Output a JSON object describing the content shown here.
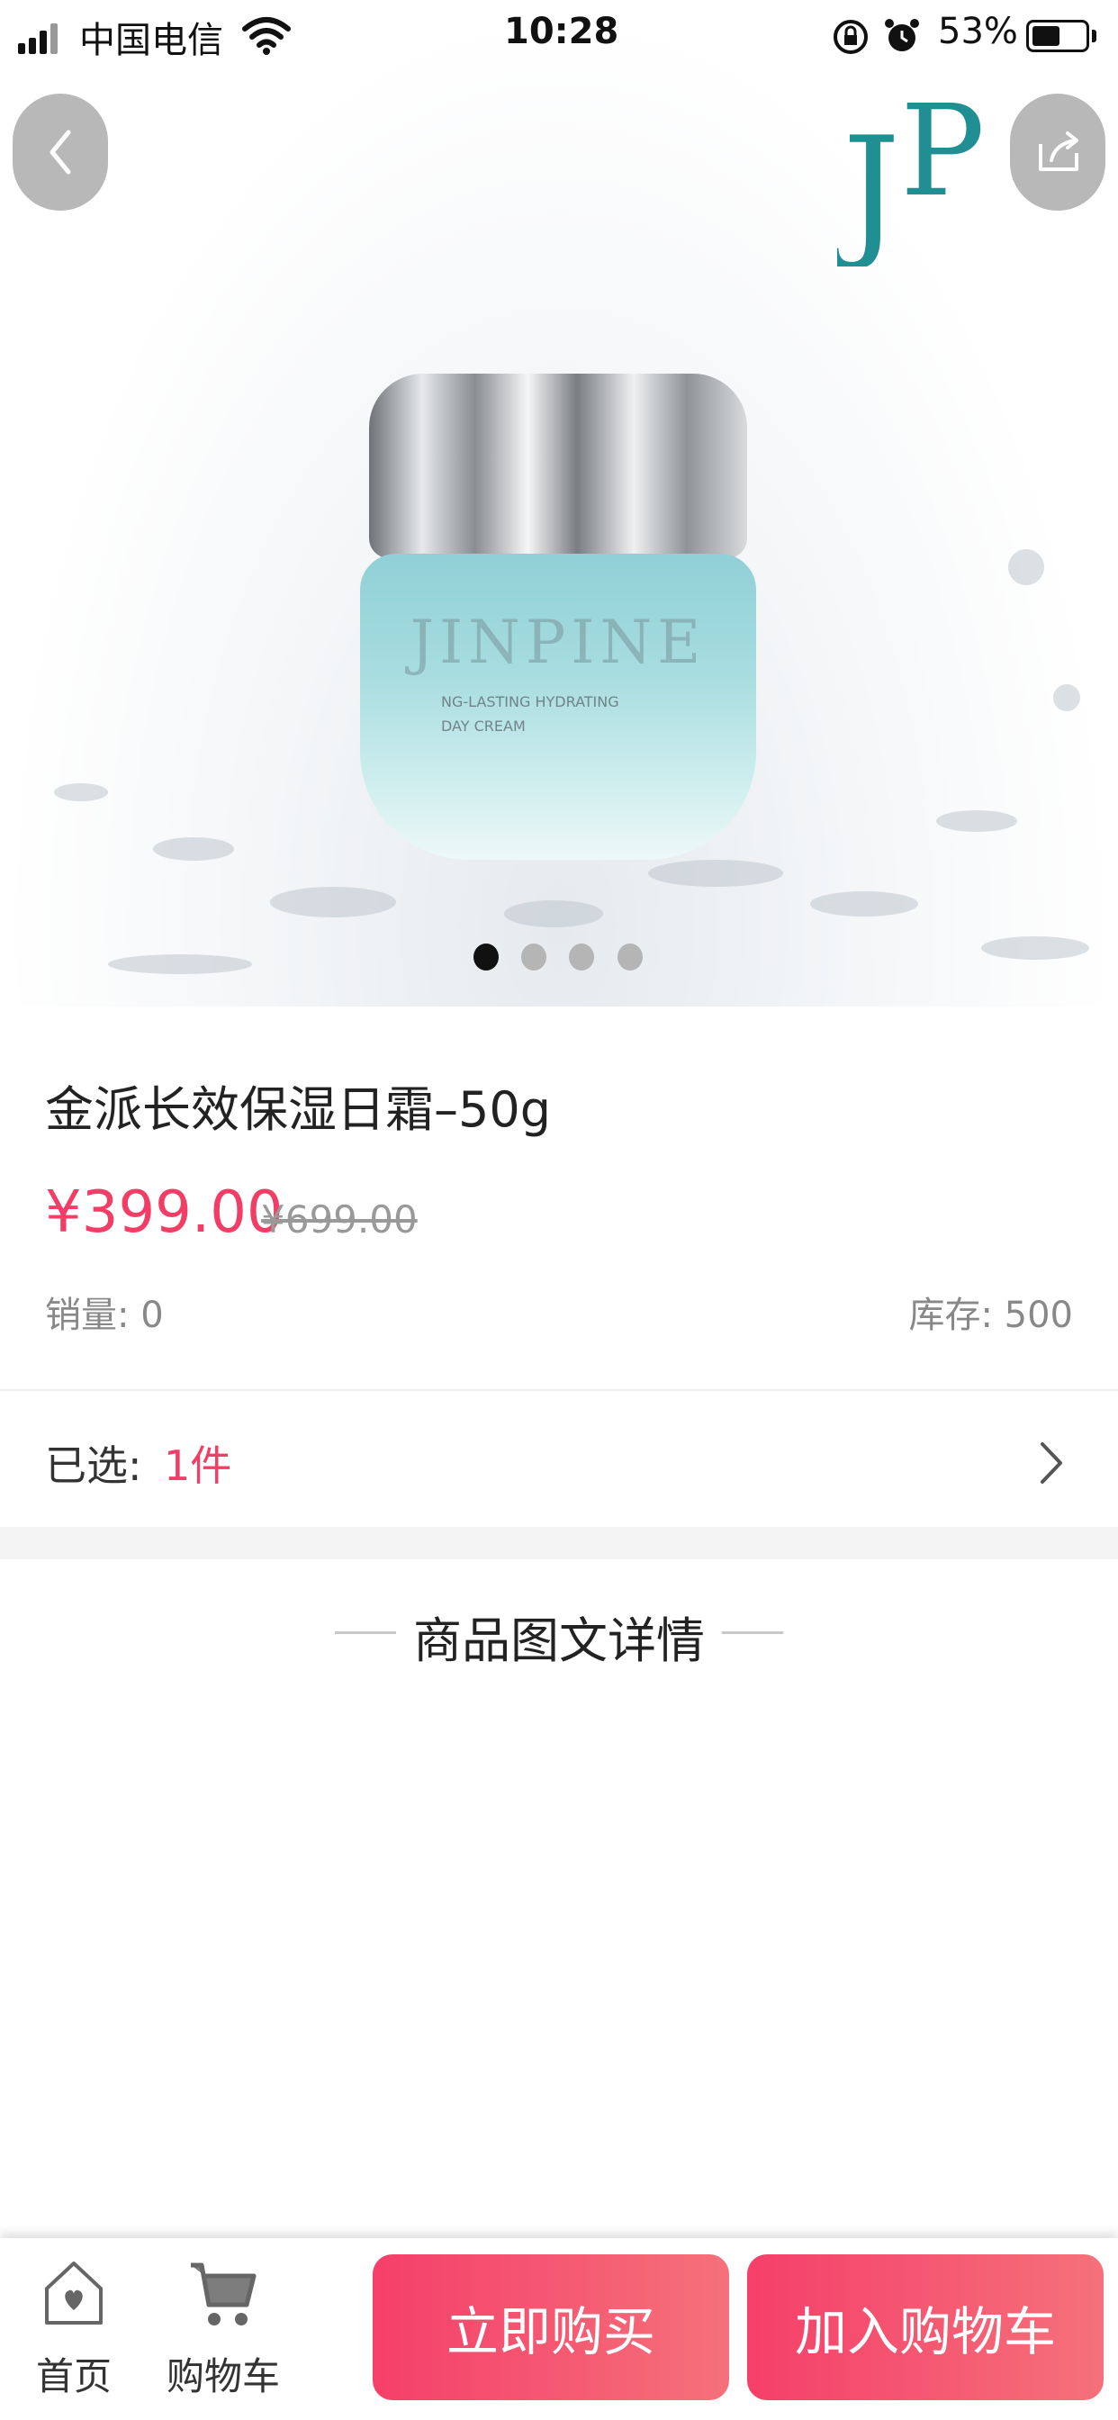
{
  "status_bar": {
    "carrier": "中国电信",
    "time": "10:28",
    "battery_percent": "53%",
    "battery_level": 0.53
  },
  "product": {
    "image_brand_text": "JINPINE",
    "image_sub_text_1": "NG-LASTING HYDRATING",
    "image_sub_text_2": "DAY CREAM",
    "brand_logo_text": "JP",
    "title": "金派长效保湿日霜–50g",
    "price_current": "¥399.00",
    "price_original": "¥699.00",
    "sales": "销量: 0",
    "stock": "库存: 500",
    "carousel": {
      "count": 4,
      "active_index": 0
    }
  },
  "selection": {
    "label": "已选:",
    "value": "1件"
  },
  "details": {
    "heading": "商品图文详情"
  },
  "bottom_bar": {
    "home_label": "首页",
    "cart_label": "购物车",
    "buy_now_label": "立即购买",
    "add_to_cart_label": "加入购物车"
  },
  "colors": {
    "accent": "#f23d66",
    "button_gradient_start": "#f53f6a",
    "button_gradient_end": "#f5717a",
    "logo_teal": "#1f8f93"
  },
  "icons": [
    "back-icon",
    "share-icon",
    "chevron-right-icon",
    "home-icon",
    "cart-icon",
    "wifi-icon",
    "signal-icon",
    "battery-icon",
    "alarm-icon",
    "rotation-lock-icon"
  ]
}
